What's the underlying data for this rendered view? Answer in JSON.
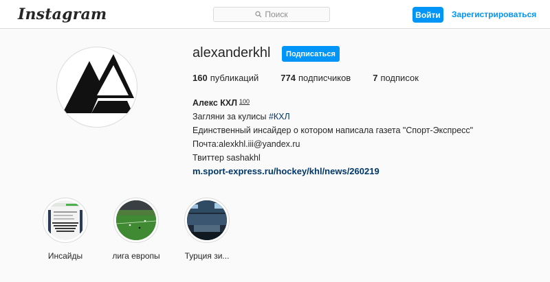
{
  "header": {
    "logo_text": "Instagram",
    "search_placeholder": "Поиск",
    "login_label": "Войти",
    "register_label": "Зарегистрироваться"
  },
  "profile": {
    "username": "alexanderkhl",
    "follow_label": "Подписаться",
    "stats": {
      "posts_count": "160",
      "posts_label": "публикаций",
      "followers_count": "774",
      "followers_label": "подписчиков",
      "following_count": "7",
      "following_label": "подписок"
    },
    "bio": {
      "name": "Алекс КХЛ",
      "name_emoji": "100",
      "line1_text": "Загляни за кулисы",
      "line1_hashtag": "#КХЛ",
      "line2": "Единственный инсайдер о котором написала газета \"Спорт-Экспресс\"",
      "line3": "Почта:alexkhl.iii@yandex.ru",
      "line4": "Твиттер sashakhl",
      "link": "m.sport-express.ru/hockey/khl/news/260219"
    }
  },
  "highlights": [
    {
      "label": "Инсайды"
    },
    {
      "label": "лига европы"
    },
    {
      "label": "Турция зи..."
    }
  ],
  "colors": {
    "accent": "#0095f6",
    "link": "#00376b",
    "border": "#dbdbdb",
    "background": "#fafafa"
  }
}
